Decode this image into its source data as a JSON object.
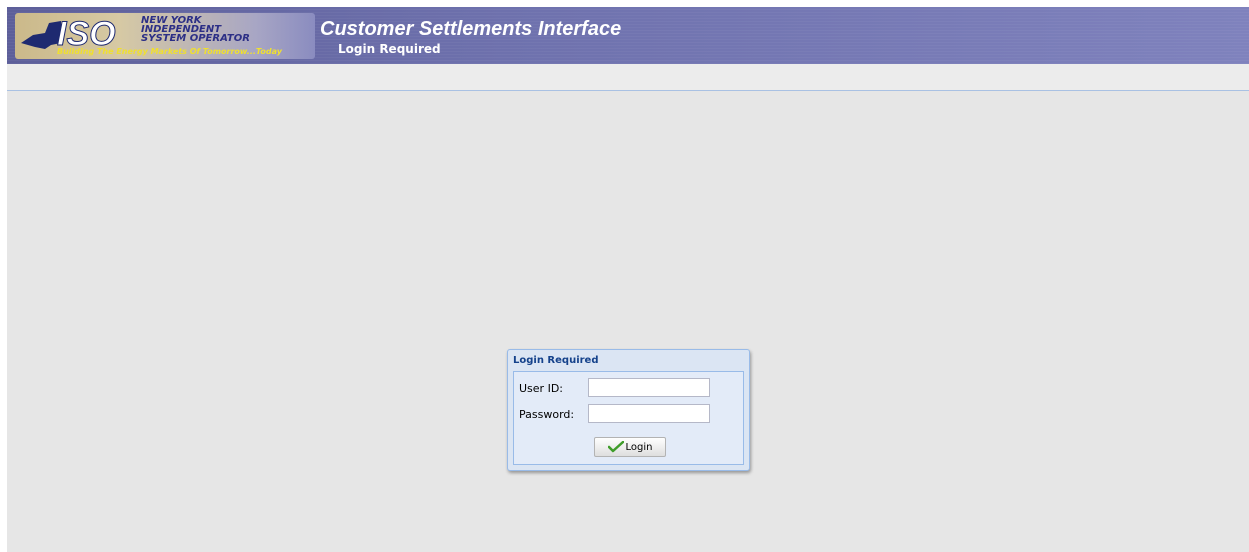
{
  "header": {
    "logo": {
      "line1": "NEW YORK",
      "line2": "INDEPENDENT",
      "line3": "SYSTEM OPERATOR",
      "tagline": "Building The Energy Markets Of Tomorrow...Today"
    },
    "app_title": "Customer Settlements Interface",
    "page_subtitle": "Login Required"
  },
  "login_dialog": {
    "title": "Login Required",
    "user_id_label": "User ID:",
    "user_id_value": "",
    "password_label": "Password:",
    "password_value": "",
    "login_button": "Login",
    "login_icon": "checkmark-icon"
  },
  "colors": {
    "header_bg": "#6e71ad",
    "page_bg": "#e6e6e6",
    "dialog_title": "#15428b",
    "checkmark": "#3f9d2a"
  }
}
